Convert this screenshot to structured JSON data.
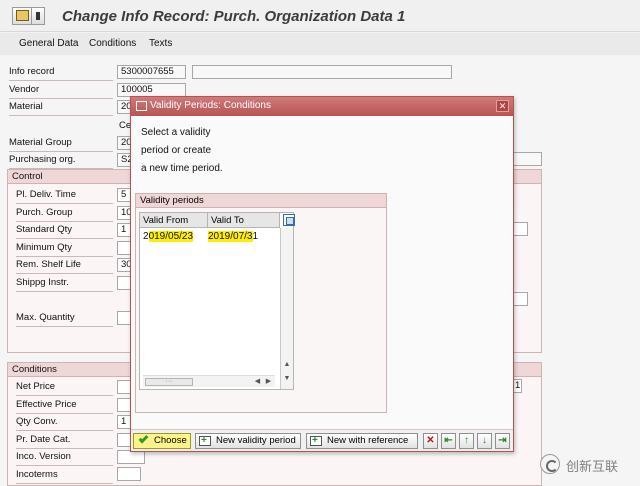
{
  "window": {
    "title": "Change Info Record: Purch. Organization Data 1"
  },
  "toolbar": {
    "items": [
      "General Data",
      "Conditions",
      "Texts"
    ]
  },
  "form": {
    "info_record_label": "Info record",
    "info_record_value": "5300007655",
    "vendor_label": "Vendor",
    "vendor_value": "100005",
    "material_label": "Material",
    "material_value": "20",
    "material_desc_partial": "Ce",
    "material_group_label": "Material Group",
    "material_group_value": "20",
    "purch_org_label": "Purchasing org.",
    "purch_org_value": "S2",
    "control": {
      "title": "Control",
      "pl_deliv_time_label": "Pl. Deliv. Time",
      "pl_deliv_time_value": "5",
      "purch_group_label": "Purch. Group",
      "purch_group_value": "10",
      "standard_qty_label": "Standard Qty",
      "standard_qty_value": "1",
      "minimum_qty_label": "Minimum Qty",
      "rem_shelf_life_label": "Rem. Shelf Life",
      "rem_shelf_life_value": "30",
      "shippg_instr_label": "Shippg Instr.",
      "max_quantity_label": "Max. Quantity"
    },
    "conditions": {
      "title": "Conditions",
      "net_price_label": "Net Price",
      "net_price_right_value": "1",
      "effective_price_label": "Effective Price",
      "qty_conv_label": "Qty Conv.",
      "qty_conv_value": "1",
      "pr_date_cat_label": "Pr. Date Cat.",
      "inco_version_label": "Inco. Version",
      "incoterms_label": "Incoterms"
    }
  },
  "dialog": {
    "title": "Validity Periods: Conditions",
    "message_lines": [
      "Select a validity",
      "period or create",
      "a new time period."
    ],
    "validity_periods": {
      "title": "Validity periods",
      "columns": [
        "Valid From",
        "Valid To"
      ],
      "rows": [
        {
          "valid_from_prefix": "2",
          "valid_from_hl": "019/05/23",
          "valid_to_hl": "2019/07/3",
          "valid_to_rest": "1"
        }
      ]
    },
    "footer": {
      "choose_label": "Choose",
      "new_validity_period_label": "New validity period",
      "new_with_reference_label": "New with reference"
    },
    "colors": {
      "title_bar": "#b85454",
      "highlight": "#ffee00"
    }
  },
  "watermark": {
    "text": "创新互联"
  }
}
